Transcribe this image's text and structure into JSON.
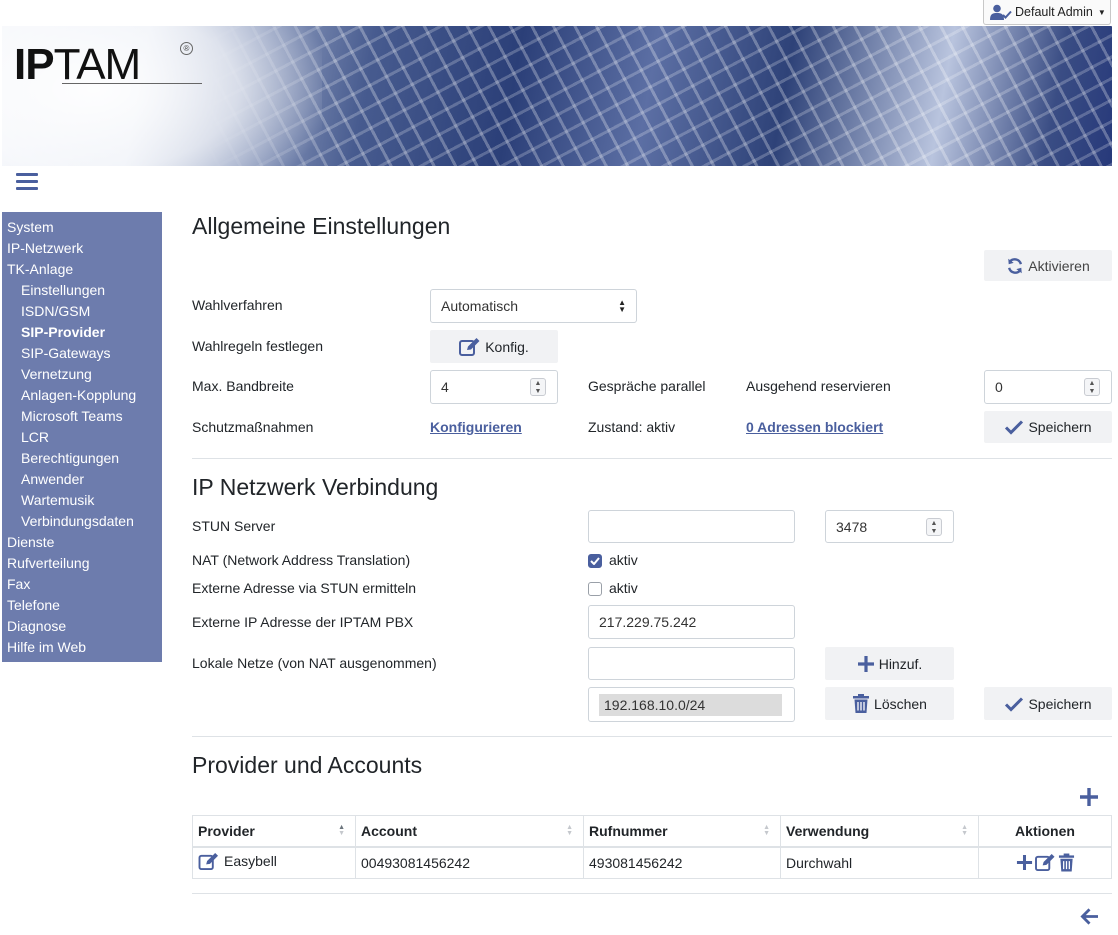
{
  "header": {
    "user_label": "Default Admin",
    "logo_text_bold": "IP",
    "logo_text": "TAM",
    "logo_mark": "®"
  },
  "sidebar": {
    "items": [
      {
        "label": "System",
        "level": 0,
        "active": false
      },
      {
        "label": "IP-Netzwerk",
        "level": 0,
        "active": false
      },
      {
        "label": "TK-Anlage",
        "level": 0,
        "active": false
      },
      {
        "label": "Einstellungen",
        "level": 1,
        "active": false
      },
      {
        "label": "ISDN/GSM",
        "level": 1,
        "active": false
      },
      {
        "label": "SIP-Provider",
        "level": 1,
        "active": true
      },
      {
        "label": "SIP-Gateways",
        "level": 1,
        "active": false
      },
      {
        "label": "Vernetzung",
        "level": 1,
        "active": false
      },
      {
        "label": "Anlagen-Kopplung",
        "level": 1,
        "active": false
      },
      {
        "label": "Microsoft Teams",
        "level": 1,
        "active": false
      },
      {
        "label": "LCR",
        "level": 1,
        "active": false
      },
      {
        "label": "Berechtigungen",
        "level": 1,
        "active": false
      },
      {
        "label": "Anwender",
        "level": 1,
        "active": false
      },
      {
        "label": "Wartemusik",
        "level": 1,
        "active": false
      },
      {
        "label": "Verbindungsdaten",
        "level": 1,
        "active": false
      },
      {
        "label": "Dienste",
        "level": 0,
        "active": false
      },
      {
        "label": "Rufverteilung",
        "level": 0,
        "active": false
      },
      {
        "label": "Fax",
        "level": 0,
        "active": false
      },
      {
        "label": "Telefone",
        "level": 0,
        "active": false
      },
      {
        "label": "Diagnose",
        "level": 0,
        "active": false
      },
      {
        "label": "Hilfe im Web",
        "level": 0,
        "active": false
      }
    ]
  },
  "general": {
    "title": "Allgemeine Einstellungen",
    "activate_label": "Aktivieren",
    "dial_method_label": "Wahlverfahren",
    "dial_method_value": "Automatisch",
    "dial_rules_label": "Wahlregeln festlegen",
    "config_button_label": "Konfig.",
    "max_bandwidth_label": "Max. Bandbreite",
    "max_bandwidth_value": "4",
    "parallel_calls_label": "Gespräche parallel",
    "outgoing_reserve_label": "Ausgehend reservieren",
    "outgoing_reserve_value": "0",
    "protection_label": "Schutzmaßnahmen",
    "configure_link": "Konfigurieren",
    "state_label": "Zustand: aktiv",
    "blocked_link": "0 Adressen blockiert",
    "save_label": "Speichern"
  },
  "network": {
    "title": "IP Netzwerk Verbindung",
    "stun_label": "STUN Server",
    "stun_value": "",
    "stun_port": "3478",
    "nat_label": "NAT (Network Address Translation)",
    "nat_checked": true,
    "nat_check_label": "aktiv",
    "stun_ext_label": "Externe Adresse via STUN ermitteln",
    "stun_ext_checked": false,
    "stun_ext_check_label": "aktiv",
    "ext_ip_label": "Externe IP Adresse der IPTAM PBX",
    "ext_ip_value": "217.229.75.242",
    "local_nets_label": "Lokale Netze (von NAT ausgenommen)",
    "local_net_input": "",
    "add_label": "Hinzuf.",
    "local_net_entry": "192.168.10.0/24",
    "delete_label": "Löschen",
    "save_label": "Speichern"
  },
  "providers": {
    "title": "Provider und Accounts",
    "columns": [
      "Provider",
      "Account",
      "Rufnummer",
      "Verwendung",
      "Aktionen"
    ],
    "rows": [
      {
        "provider": "Easybell",
        "account": "00493081456242",
        "number": "493081456242",
        "usage": "Durchwahl"
      }
    ]
  },
  "colors": {
    "accent": "#4a5f9e",
    "sidebar_bg": "#6d7cad",
    "button_bg": "#f1f2f4"
  }
}
